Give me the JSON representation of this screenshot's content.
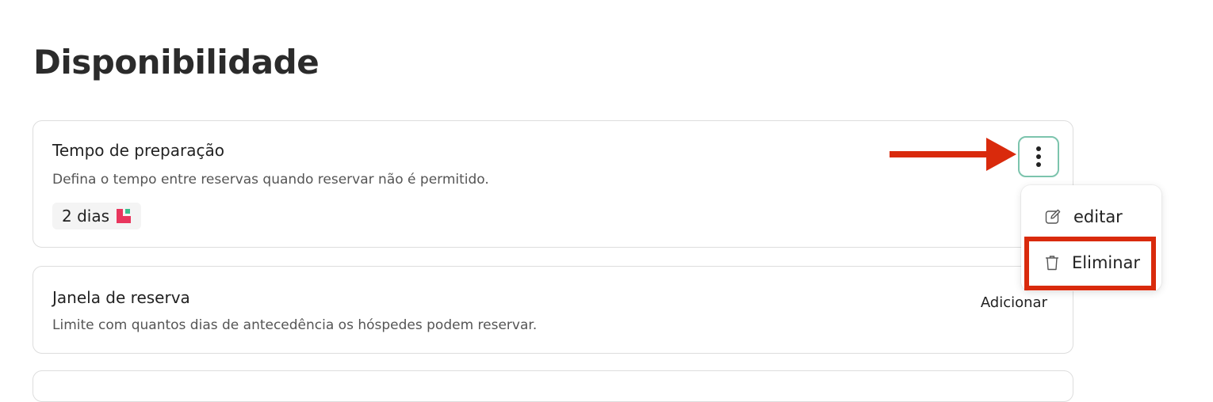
{
  "page": {
    "title": "Disponibilidade"
  },
  "cards": [
    {
      "title": "Tempo de preparação",
      "description": "Defina o tempo entre reservas quando reservar não é permitido.",
      "value": "2 dias"
    },
    {
      "title": "Janela de reserva",
      "description": "Limite com quantos dias de antecedência os hóspedes podem reservar.",
      "action_label": "Adicionar"
    }
  ],
  "menu": {
    "items": [
      {
        "label": "editar",
        "icon": "pencil-edit-icon"
      },
      {
        "label": "Eliminar",
        "icon": "trash-icon"
      }
    ]
  },
  "icons": {
    "more_button": "vertical-dots-icon",
    "annotation_arrow": "red-arrow-right",
    "chip_logo": "brand-logo"
  },
  "colors": {
    "annotation_red": "#d92a0c",
    "more_button_border": "#7cc4ad",
    "logo_red": "#e8365d",
    "logo_green": "#3bbf8f"
  }
}
